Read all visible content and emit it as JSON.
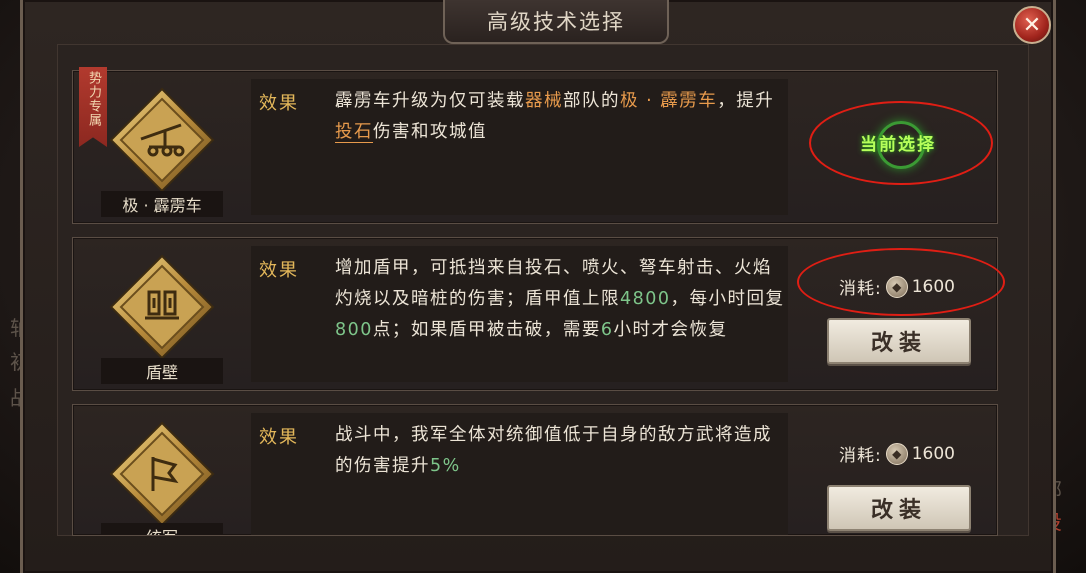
{
  "dialog": {
    "title": "高级技术选择",
    "close_icon": "close-x-icon"
  },
  "background_text": {
    "left": [
      "轴",
      "初",
      "战"
    ],
    "right": [
      "部",
      "投"
    ]
  },
  "techs": [
    {
      "name": "极 · 霹雳车",
      "icon": "catapult-icon",
      "ribbon": "势力专属",
      "effect_label": "效果",
      "desc_parts": [
        {
          "t": "霹雳车升级为仅可装载",
          "c": ""
        },
        {
          "t": "器械",
          "c": "orange"
        },
        {
          "t": "部队的",
          "c": ""
        },
        {
          "t": "极 · 霹雳车",
          "c": "orange"
        },
        {
          "t": "，提升",
          "c": ""
        },
        {
          "t": "投石",
          "c": "orange-u"
        },
        {
          "t": "伤害和攻城值",
          "c": ""
        }
      ],
      "status": "当前选择"
    },
    {
      "name": "盾壁",
      "icon": "shield-wall-icon",
      "effect_label": "效果",
      "desc_parts": [
        {
          "t": "增加盾甲，可抵挡来自投石、喷火、弩车射击、火焰灼烧以及暗桩的伤害；盾甲值上限",
          "c": ""
        },
        {
          "t": "4800",
          "c": "green"
        },
        {
          "t": "，每小时回复",
          "c": ""
        },
        {
          "t": "800",
          "c": "green"
        },
        {
          "t": "点；如果盾甲被击破，需要",
          "c": ""
        },
        {
          "t": "6",
          "c": "green"
        },
        {
          "t": "小时才会恢复",
          "c": ""
        }
      ],
      "cost_label": "消耗:",
      "cost_value": "1600",
      "button": "改装"
    },
    {
      "name": "统军",
      "icon": "banner-icon",
      "effect_label": "效果",
      "desc_parts": [
        {
          "t": "战斗中，我军全体对统御值低于自身的敌方武将造成的伤害提升",
          "c": ""
        },
        {
          "t": "5%",
          "c": "green"
        }
      ],
      "cost_label": "消耗:",
      "cost_value": "1600",
      "button": "改装"
    }
  ]
}
